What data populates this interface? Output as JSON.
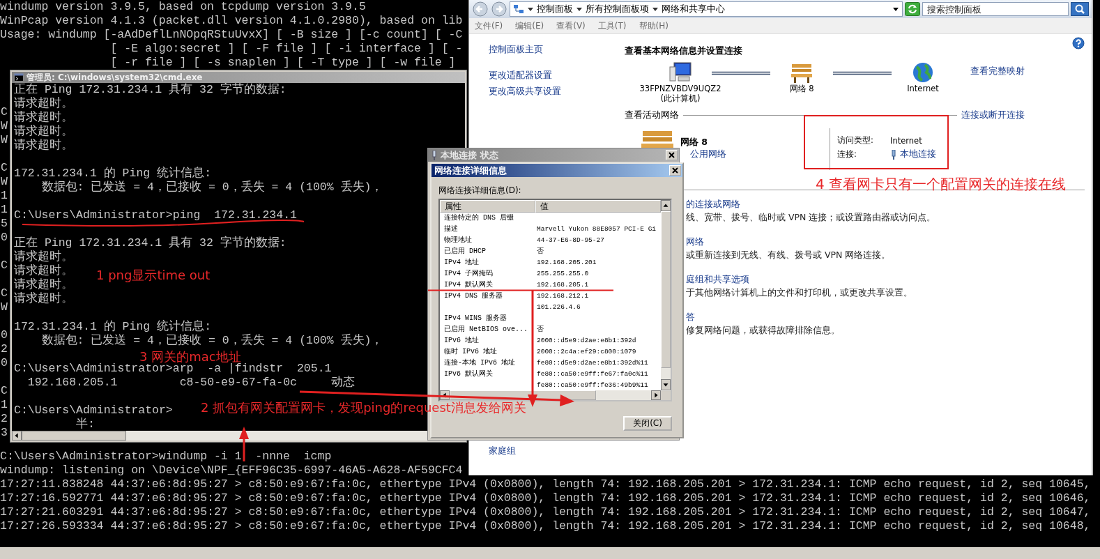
{
  "background_console": {
    "top_lines": [
      "windump version 3.9.5, based on tcpdump version 3.9.5",
      "WinPcap version 4.1.3 (packet.dll version 4.1.0.2980), based on lib",
      "Usage: windump [-aAdDeflLnNOpqRStuUvxX] [ -B size ] [-c count] [ -C",
      "                [ -E algo:secret ] [ -F file ] [ -i interface ] [ -",
      "                [ -r file ] [ -s snaplen ] [ -T type ] [ -w file ]"
    ],
    "edge_chars": [
      [
        "C",
        "W",
        "W"
      ],
      [
        "C",
        "W",
        "1",
        "1",
        "5",
        "0"
      ],
      [
        "C"
      ],
      [
        "C",
        "W"
      ],
      [
        "0",
        "2",
        "0"
      ],
      [
        "C",
        "1",
        "2",
        "3"
      ]
    ],
    "bottom_lines": [
      "C:\\Users\\Administrator>windump -i 1  -nnne  icmp",
      "windump: listening on \\Device\\NPF_{EFF96C35-6997-46A5-A628-AF59CFC4",
      "17:27:11.838248 44:37:e6:8d:95:27 > c8:50:e9:67:fa:0c, ethertype IPv4 (0x0800), length 74: 192.168.205.201 > 172.31.234.1: ICMP echo request, id 2, seq 10645,",
      "17:27:16.592771 44:37:e6:8d:95:27 > c8:50:e9:67:fa:0c, ethertype IPv4 (0x0800), length 74: 192.168.205.201 > 172.31.234.1: ICMP echo request, id 2, seq 10646,",
      "17:27:21.603291 44:37:e6:8d:95:27 > c8:50:e9:67:fa:0c, ethertype IPv4 (0x0800), length 74: 192.168.205.201 > 172.31.234.1: ICMP echo request, id 2, seq 10647,",
      "17:27:26.593334 44:37:e6:8d:95:27 > c8:50:e9:67:fa:0c, ethertype IPv4 (0x0800), length 74: 192.168.205.201 > 172.31.234.1: ICMP echo request, id 2, seq 10648,"
    ]
  },
  "cmd_window": {
    "title": "管理员: C:\\windows\\system32\\cmd.exe",
    "blocks": [
      [
        "正在 Ping 172.31.234.1 具有 32 字节的数据:",
        "请求超时。",
        "请求超时。",
        "请求超时。",
        "请求超时。"
      ],
      [
        "172.31.234.1 的 Ping 统计信息:",
        "    数据包: 已发送 = 4，已接收 = 0，丢失 = 4 (100% 丢失)，"
      ],
      [
        "C:\\Users\\Administrator>ping  172.31.234.1"
      ],
      [
        "正在 Ping 172.31.234.1 具有 32 字节的数据:",
        "请求超时。",
        "请求超时。",
        "请求超时。",
        "请求超时。"
      ],
      [
        "172.31.234.1 的 Ping 统计信息:",
        "    数据包: 已发送 = 4，已接收 = 0，丢失 = 4 (100% 丢失)，"
      ],
      [
        "C:\\Users\\Administrator>arp  -a |findstr  205.1",
        "  192.168.205.1         c8-50-e9-67-fa-0c     动态"
      ],
      [
        "C:\\Users\\Administrator>",
        "         半:"
      ]
    ]
  },
  "control_panel": {
    "breadcrumb": [
      "控制面板",
      "所有控制面板项",
      "网络和共享中心"
    ],
    "search": {
      "placeholder": "搜索控制面板"
    },
    "menu": [
      "文件(F)",
      "编辑(E)",
      "查看(V)",
      "工具(T)",
      "帮助(H)"
    ],
    "sidebar_links": [
      "控制面板主页",
      "更改适配器设置",
      "更改高级共享设置"
    ],
    "sidebar_bottom_links": [
      "家庭组"
    ],
    "heading": "查看基本网络信息并设置连接",
    "map_nodes": [
      {
        "kind": "computer",
        "label": "33FPNZVBDV9UQZ2",
        "sublabel": "(此计算机)"
      },
      {
        "kind": "network",
        "label": "网络 8"
      },
      {
        "kind": "internet",
        "label": "Internet"
      }
    ],
    "full_map_link": "查看完整映射",
    "active_heading": "查看活动网络",
    "connect_link": "连接或断开连接",
    "active_network": {
      "name": "网络 8",
      "type": "公用网络",
      "access_label": "访问类型:",
      "access_value": "Internet",
      "connection_label": "连接:",
      "connection_value": "本地连接"
    },
    "tasks": [
      {
        "link": "的连接或网络",
        "description": "线、宽带、拨号、临时或 VPN 连接；或设置路由器或访问点。"
      },
      {
        "link": "网络",
        "description": "或重新连接到无线、有线、拨号或 VPN 网络连接。"
      },
      {
        "link": "庭组和共享选项",
        "description": "于其他网络计算机上的文件和打印机，或更改共享设置。"
      },
      {
        "link": "答",
        "description": "修复网络问题，或获得故障排除信息。"
      }
    ]
  },
  "status_dialog": {
    "title": "本地连接 状态"
  },
  "details_dialog": {
    "title": "网络连接详细信息",
    "label": "网络连接详细信息(D):",
    "columns": [
      "属性",
      "值"
    ],
    "rows": [
      {
        "property": "连接特定的 DNS 后缀"
      },
      {
        "property": "描述",
        "value": "Marvell Yukon 88E8057 PCI-E Gi"
      },
      {
        "property": "物理地址",
        "value": "44-37-E6-8D-95-27"
      },
      {
        "property": "已启用 DHCP",
        "value": "否"
      },
      {
        "property": "IPv4 地址",
        "value": "192.168.205.201"
      },
      {
        "property": "IPv4 子网掩码",
        "value": "255.255.255.0"
      },
      {
        "property": "IPv4 默认网关",
        "value": "192.168.205.1"
      },
      {
        "property": "IPv4 DNS 服务器",
        "value": "192.168.212.1"
      },
      {
        "value": "101.226.4.6"
      },
      {
        "property": "IPv4 WINS 服务器"
      },
      {
        "property": "已启用 NetBIOS ove...",
        "value": "否"
      },
      {
        "property": "IPv6 地址",
        "value": "2000::d5e9:d2ae:e8b1:392d"
      },
      {
        "property": "临时 IPv6 地址",
        "value": "2000::2c4a:ef29:c800:1079"
      },
      {
        "property": "连接-本地 IPv6 地址",
        "value": "fe80::d5e9:d2ae:e8b1:392d%11"
      },
      {
        "property": "IPv6 默认网关",
        "value": "fe80::ca50:e9ff:fe67:fa0c%11"
      },
      {
        "value": "fe80::ca50:e9ff:fe36:49b9%11"
      }
    ],
    "close_button": "关闭(C)"
  },
  "annotations": [
    {
      "text": "1  png显示time out"
    },
    {
      "text": "3 网关的mac地址"
    },
    {
      "text": "2 抓包有网关配置网卡，发现ping的request消息发给网关"
    },
    {
      "text": "4 查看网卡只有一个配置网关的连接在线"
    }
  ]
}
